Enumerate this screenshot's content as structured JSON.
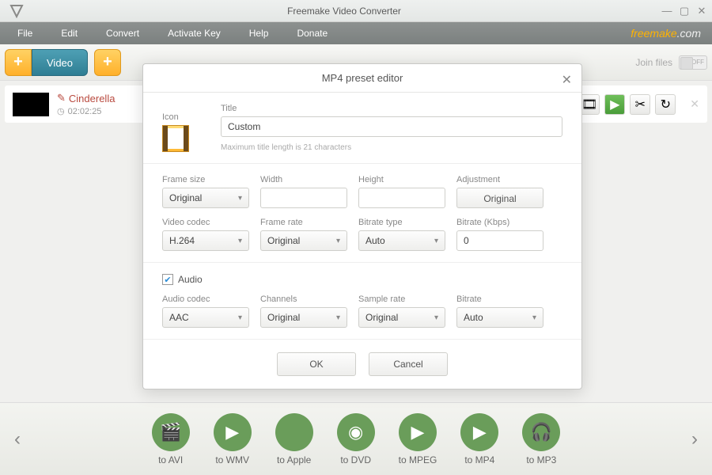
{
  "titlebar": {
    "title": "Freemake Video Converter"
  },
  "menu": {
    "items": [
      "File",
      "Edit",
      "Convert",
      "Activate Key",
      "Help",
      "Donate"
    ],
    "brand1": "freemake",
    "brand2": ".com"
  },
  "toolbar": {
    "video": "Video",
    "join_label": "Join files",
    "join_state": "OFF"
  },
  "file": {
    "name": "Cinderella",
    "duration": "02:02:25"
  },
  "modal": {
    "title": "MP4 preset editor",
    "icon_label": "Icon",
    "title_label": "Title",
    "title_value": "Custom",
    "title_hint": "Maximum title length is 21 characters",
    "frame_size_label": "Frame size",
    "frame_size": "Original",
    "width_label": "Width",
    "width": "",
    "height_label": "Height",
    "height": "",
    "adjustment_label": "Adjustment",
    "adjustment": "Original",
    "video_codec_label": "Video codec",
    "video_codec": "H.264",
    "frame_rate_label": "Frame rate",
    "frame_rate": "Original",
    "bitrate_type_label": "Bitrate type",
    "bitrate_type": "Auto",
    "bitrate_kbps_label": "Bitrate (Kbps)",
    "bitrate_kbps": "0",
    "audio_label": "Audio",
    "audio_codec_label": "Audio codec",
    "audio_codec": "AAC",
    "channels_label": "Channels",
    "channels": "Original",
    "sample_rate_label": "Sample rate",
    "sample_rate": "Original",
    "abitrate_label": "Bitrate",
    "abitrate": "Auto",
    "ok": "OK",
    "cancel": "Cancel"
  },
  "formats": [
    "to AVI",
    "to WMV",
    "to Apple",
    "to DVD",
    "to MPEG",
    "to MP4",
    "to MP3"
  ]
}
